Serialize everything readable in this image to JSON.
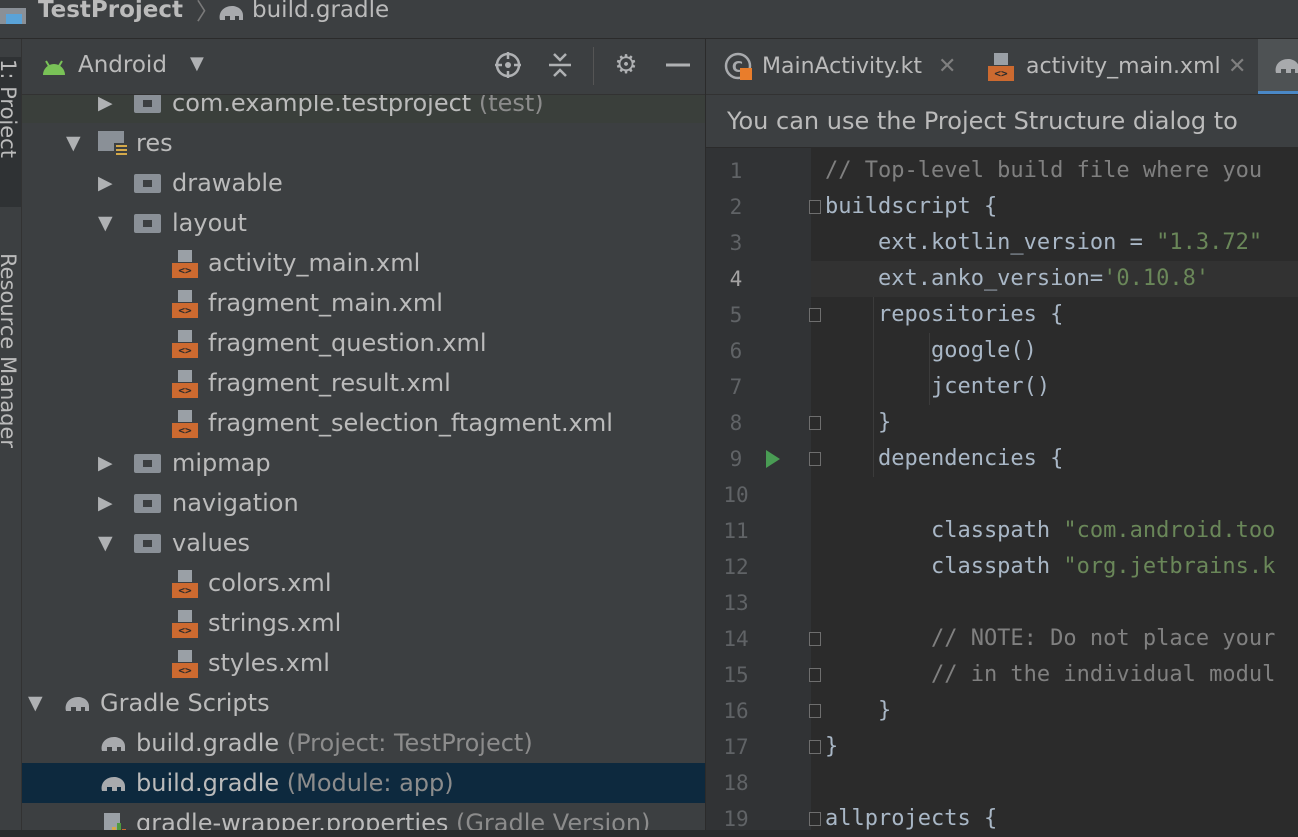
{
  "breadcrumb": {
    "project": "TestProject",
    "separator": "〉",
    "file": "build.gradle"
  },
  "toolstrip": {
    "project_tab": "1: Project",
    "resource_tab": "Resource Manager"
  },
  "project_panel": {
    "view_selector": "Android",
    "tree": [
      {
        "label": "com.example.testproject",
        "hint": "(test)",
        "kind": "package",
        "expanded": false
      },
      {
        "label": "res",
        "hint": "",
        "kind": "resfolder",
        "expanded": true
      },
      {
        "label": "drawable",
        "hint": "",
        "kind": "folder",
        "expanded": false
      },
      {
        "label": "layout",
        "hint": "",
        "kind": "folder",
        "expanded": true
      },
      {
        "label": "activity_main.xml",
        "hint": "",
        "kind": "xml"
      },
      {
        "label": "fragment_main.xml",
        "hint": "",
        "kind": "xml"
      },
      {
        "label": "fragment_question.xml",
        "hint": "",
        "kind": "xml"
      },
      {
        "label": "fragment_result.xml",
        "hint": "",
        "kind": "xml"
      },
      {
        "label": "fragment_selection_ftagment.xml",
        "hint": "",
        "kind": "xml"
      },
      {
        "label": "mipmap",
        "hint": "",
        "kind": "folder",
        "expanded": false
      },
      {
        "label": "navigation",
        "hint": "",
        "kind": "folder",
        "expanded": false
      },
      {
        "label": "values",
        "hint": "",
        "kind": "folder",
        "expanded": true
      },
      {
        "label": "colors.xml",
        "hint": "",
        "kind": "xml"
      },
      {
        "label": "strings.xml",
        "hint": "",
        "kind": "xml"
      },
      {
        "label": "styles.xml",
        "hint": "",
        "kind": "xml"
      },
      {
        "label": "Gradle Scripts",
        "hint": "",
        "kind": "gradle-root",
        "expanded": true
      },
      {
        "label": "build.gradle",
        "hint": "(Project: TestProject)",
        "kind": "gradle"
      },
      {
        "label": "build.gradle",
        "hint": "(Module: app)",
        "kind": "gradle",
        "selected": true
      },
      {
        "label": "gradle-wrapper.properties",
        "hint": "(Gradle Version)",
        "kind": "properties"
      }
    ]
  },
  "editor": {
    "tabs": [
      {
        "label": "MainActivity.kt",
        "icon": "kotlin-file-icon"
      },
      {
        "label": "activity_main.xml",
        "icon": "xml-file-icon"
      }
    ],
    "notice": "You can use the Project Structure dialog to",
    "current_line": 4,
    "lines": [
      {
        "n": "1",
        "text": "// Top-level build file where you",
        "type": "comment"
      },
      {
        "n": "2",
        "text": "buildscript {",
        "type": "code"
      },
      {
        "n": "3",
        "pre": "    ext.kotlin_version = ",
        "str": "\"1.3.72\"",
        "type": "mixed"
      },
      {
        "n": "4",
        "pre": "    ext.anko_version=",
        "str": "'0.10.8'",
        "type": "mixed"
      },
      {
        "n": "5",
        "text": "    repositories {",
        "type": "code"
      },
      {
        "n": "6",
        "text": "        google()",
        "type": "code"
      },
      {
        "n": "7",
        "text": "        jcenter()",
        "type": "code"
      },
      {
        "n": "8",
        "text": "    }",
        "type": "code"
      },
      {
        "n": "9",
        "text": "    dependencies {",
        "type": "code"
      },
      {
        "n": "10",
        "text": "",
        "type": "code"
      },
      {
        "n": "11",
        "pre": "        classpath ",
        "str": "\"com.android.too",
        "type": "mixed"
      },
      {
        "n": "12",
        "pre": "        classpath ",
        "str": "\"org.jetbrains.k",
        "type": "mixed"
      },
      {
        "n": "13",
        "text": "",
        "type": "code"
      },
      {
        "n": "14",
        "text": "        // NOTE: Do not place your",
        "type": "comment"
      },
      {
        "n": "15",
        "text": "        // in the individual modul",
        "type": "comment"
      },
      {
        "n": "16",
        "text": "    }",
        "type": "code"
      },
      {
        "n": "17",
        "text": "}",
        "type": "code"
      },
      {
        "n": "18",
        "text": "",
        "type": "code"
      },
      {
        "n": "19",
        "text": "allprojects {",
        "type": "code"
      }
    ]
  },
  "colors": {
    "panel_bg": "#3c3f41",
    "editor_bg": "#2b2b2b",
    "selection": "#0d293e",
    "string": "#6a8759",
    "comment": "#808080",
    "xml_badge": "#cc6a30",
    "run_marker": "#499c54"
  }
}
